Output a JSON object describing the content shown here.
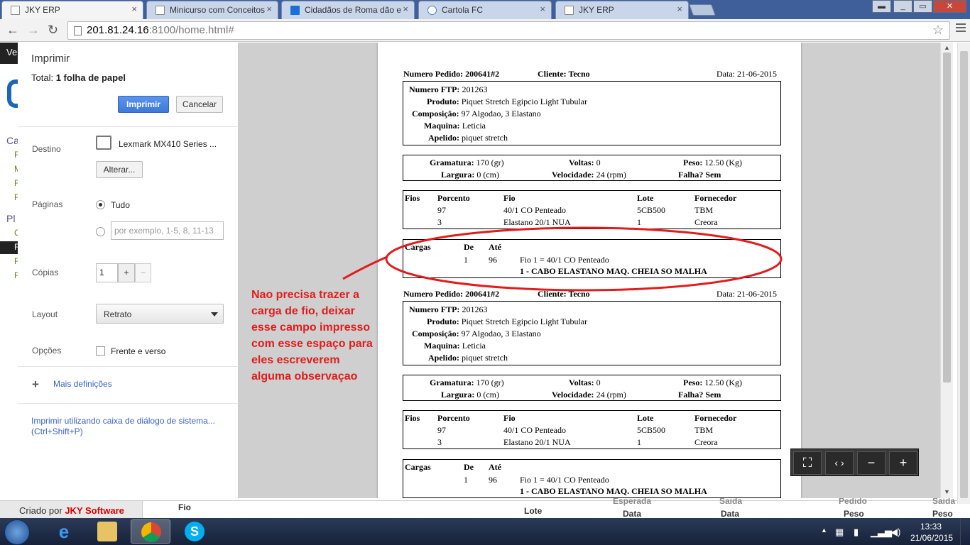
{
  "browser": {
    "tabs": [
      {
        "title": "JKY ERP",
        "active": true
      },
      {
        "title": "Minicurso com Conceitos",
        "active": false
      },
      {
        "title": "Cidadãos de Roma dão e",
        "active": false
      },
      {
        "title": "Cartola FC",
        "active": false
      },
      {
        "title": "JKY ERP",
        "active": false
      }
    ],
    "url_host": "201.81.24.16",
    "url_rest": ":8100/home.html#"
  },
  "print_dialog": {
    "title": "Imprimir",
    "total_label": "Total:",
    "total_value": "1 folha de papel",
    "print_button": "Imprimir",
    "cancel_button": "Cancelar",
    "destination_label": "Destino",
    "printer_name": "Lexmark MX410 Series ...",
    "change_button": "Alterar...",
    "pages_label": "Páginas",
    "pages_all": "Tudo",
    "pages_placeholder": "por exemplo, 1-5, 8, 11-13",
    "copies_label": "Cópias",
    "copies_value": "1",
    "copies_plus": "+",
    "copies_minus": "−",
    "layout_label": "Layout",
    "layout_value": "Retrato",
    "options_label": "Opções",
    "duplex_label": "Frente e verso",
    "more_settings": "Mais definições",
    "system_dialog_link": "Imprimir utilizando caixa de diálogo de sistema... (Ctrl+Shift+P)"
  },
  "document": {
    "order_label": "Numero Pedido:",
    "order_value": "200641#2",
    "client_label": "Cliente:",
    "client_value": "Tecno",
    "date_label": "Data:",
    "date_value": "21-06-2015",
    "ftp_label": "Numero FTP:",
    "ftp_value": "201263",
    "product_label": "Produto:",
    "product_value": "Piquet Stretch Egipcio Light Tubular",
    "composition_label": "Composição:",
    "composition_value": "97 Algodao, 3 Elastano",
    "machine_label": "Maquina:",
    "machine_value": "Leticia",
    "nickname_label": "Apelido:",
    "nickname_value": "piquet stretch",
    "grammage_label": "Gramatura:",
    "grammage_value": "170 (gr)",
    "turns_label": "Voltas:",
    "turns_value": "0",
    "weight_label": "Peso:",
    "weight_value": "12.50 (Kg)",
    "width_label": "Largura:",
    "width_value": "0 (cm)",
    "speed_label": "Velocidade:",
    "speed_value": "24 (rpm)",
    "fault_label": "Falha? Sem",
    "yarn_headers": [
      "Fios",
      "Porcento",
      "Fio",
      "Lote",
      "Fornecedor"
    ],
    "yarn_rows": [
      [
        "97",
        "40/1 CO Penteado",
        "5CB500",
        "TBM"
      ],
      [
        "3",
        "Elastano 20/1 NUA",
        "1",
        "Creora"
      ]
    ],
    "load_headers": [
      "Cargas",
      "De",
      "Até"
    ],
    "load_from": "1",
    "load_to": "96",
    "load_yarn": "Fio 1 = 40/1 CO Penteado",
    "load_note": "1 - CABO ELASTANO MAQ. CHEIA SO MALHA"
  },
  "annotation": {
    "text": "Nao precisa trazer a carga de fio, deixar esse campo impresso com esse espaço para eles escreverem alguma observaçao",
    "color": "#e21c1c"
  },
  "background_app": {
    "credit_prefix": "Criado por",
    "credit_brand": "JKY Software",
    "columns": [
      {
        "top": "",
        "bottom": "Fio"
      },
      {
        "top": "",
        "bottom": "Lote"
      },
      {
        "top": "Esperada",
        "bottom": "Data"
      },
      {
        "top": "Saida",
        "bottom": "Data"
      },
      {
        "top": "Pedido",
        "bottom": "Peso"
      },
      {
        "top": "Saida",
        "bottom": "Peso"
      }
    ],
    "sidebar_fragments": [
      "Ve",
      "Ca",
      "F",
      "M",
      "F",
      "F",
      "Pl",
      "C",
      "F",
      "F",
      "F"
    ]
  },
  "taskbar": {
    "time": "13:33",
    "date": "21/06/2015"
  }
}
